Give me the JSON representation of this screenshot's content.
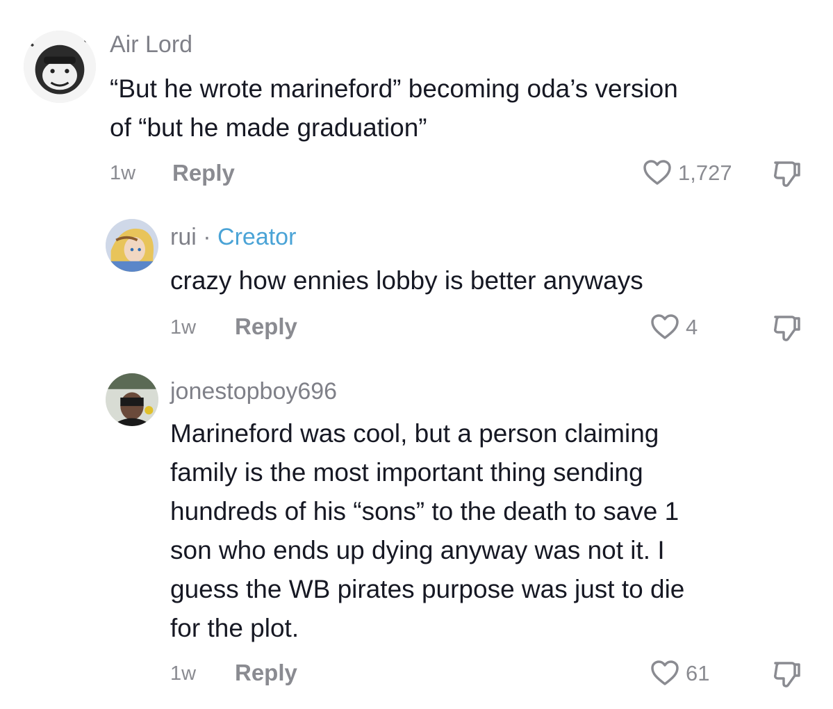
{
  "comments": [
    {
      "username": "Air Lord",
      "text": "“But he wrote marineford” becoming oda’s version\nof “but he made graduation”",
      "time": "1w",
      "reply_label": "Reply",
      "likes": "1,727"
    },
    {
      "username": "rui",
      "separator": "·",
      "badge": "Creator",
      "text": "crazy how ennies lobby is better anyways",
      "time": "1w",
      "reply_label": "Reply",
      "likes": "4"
    },
    {
      "username": "jonestopboy696",
      "text": "Marineford was cool, but a person claiming\nfamily is the most important thing sending\nhundreds of his “sons” to the death to save 1\nson who ends up dying anyway was not it. I\nguess the WB pirates purpose was just to die\nfor the plot.",
      "time": "1w",
      "reply_label": "Reply",
      "likes": "61"
    }
  ],
  "icons": {
    "like": "heart-outline-icon",
    "dislike": "thumbs-down-icon"
  },
  "colors": {
    "creator_badge": "#4aa3d6",
    "muted_text": "#8a8b91"
  }
}
